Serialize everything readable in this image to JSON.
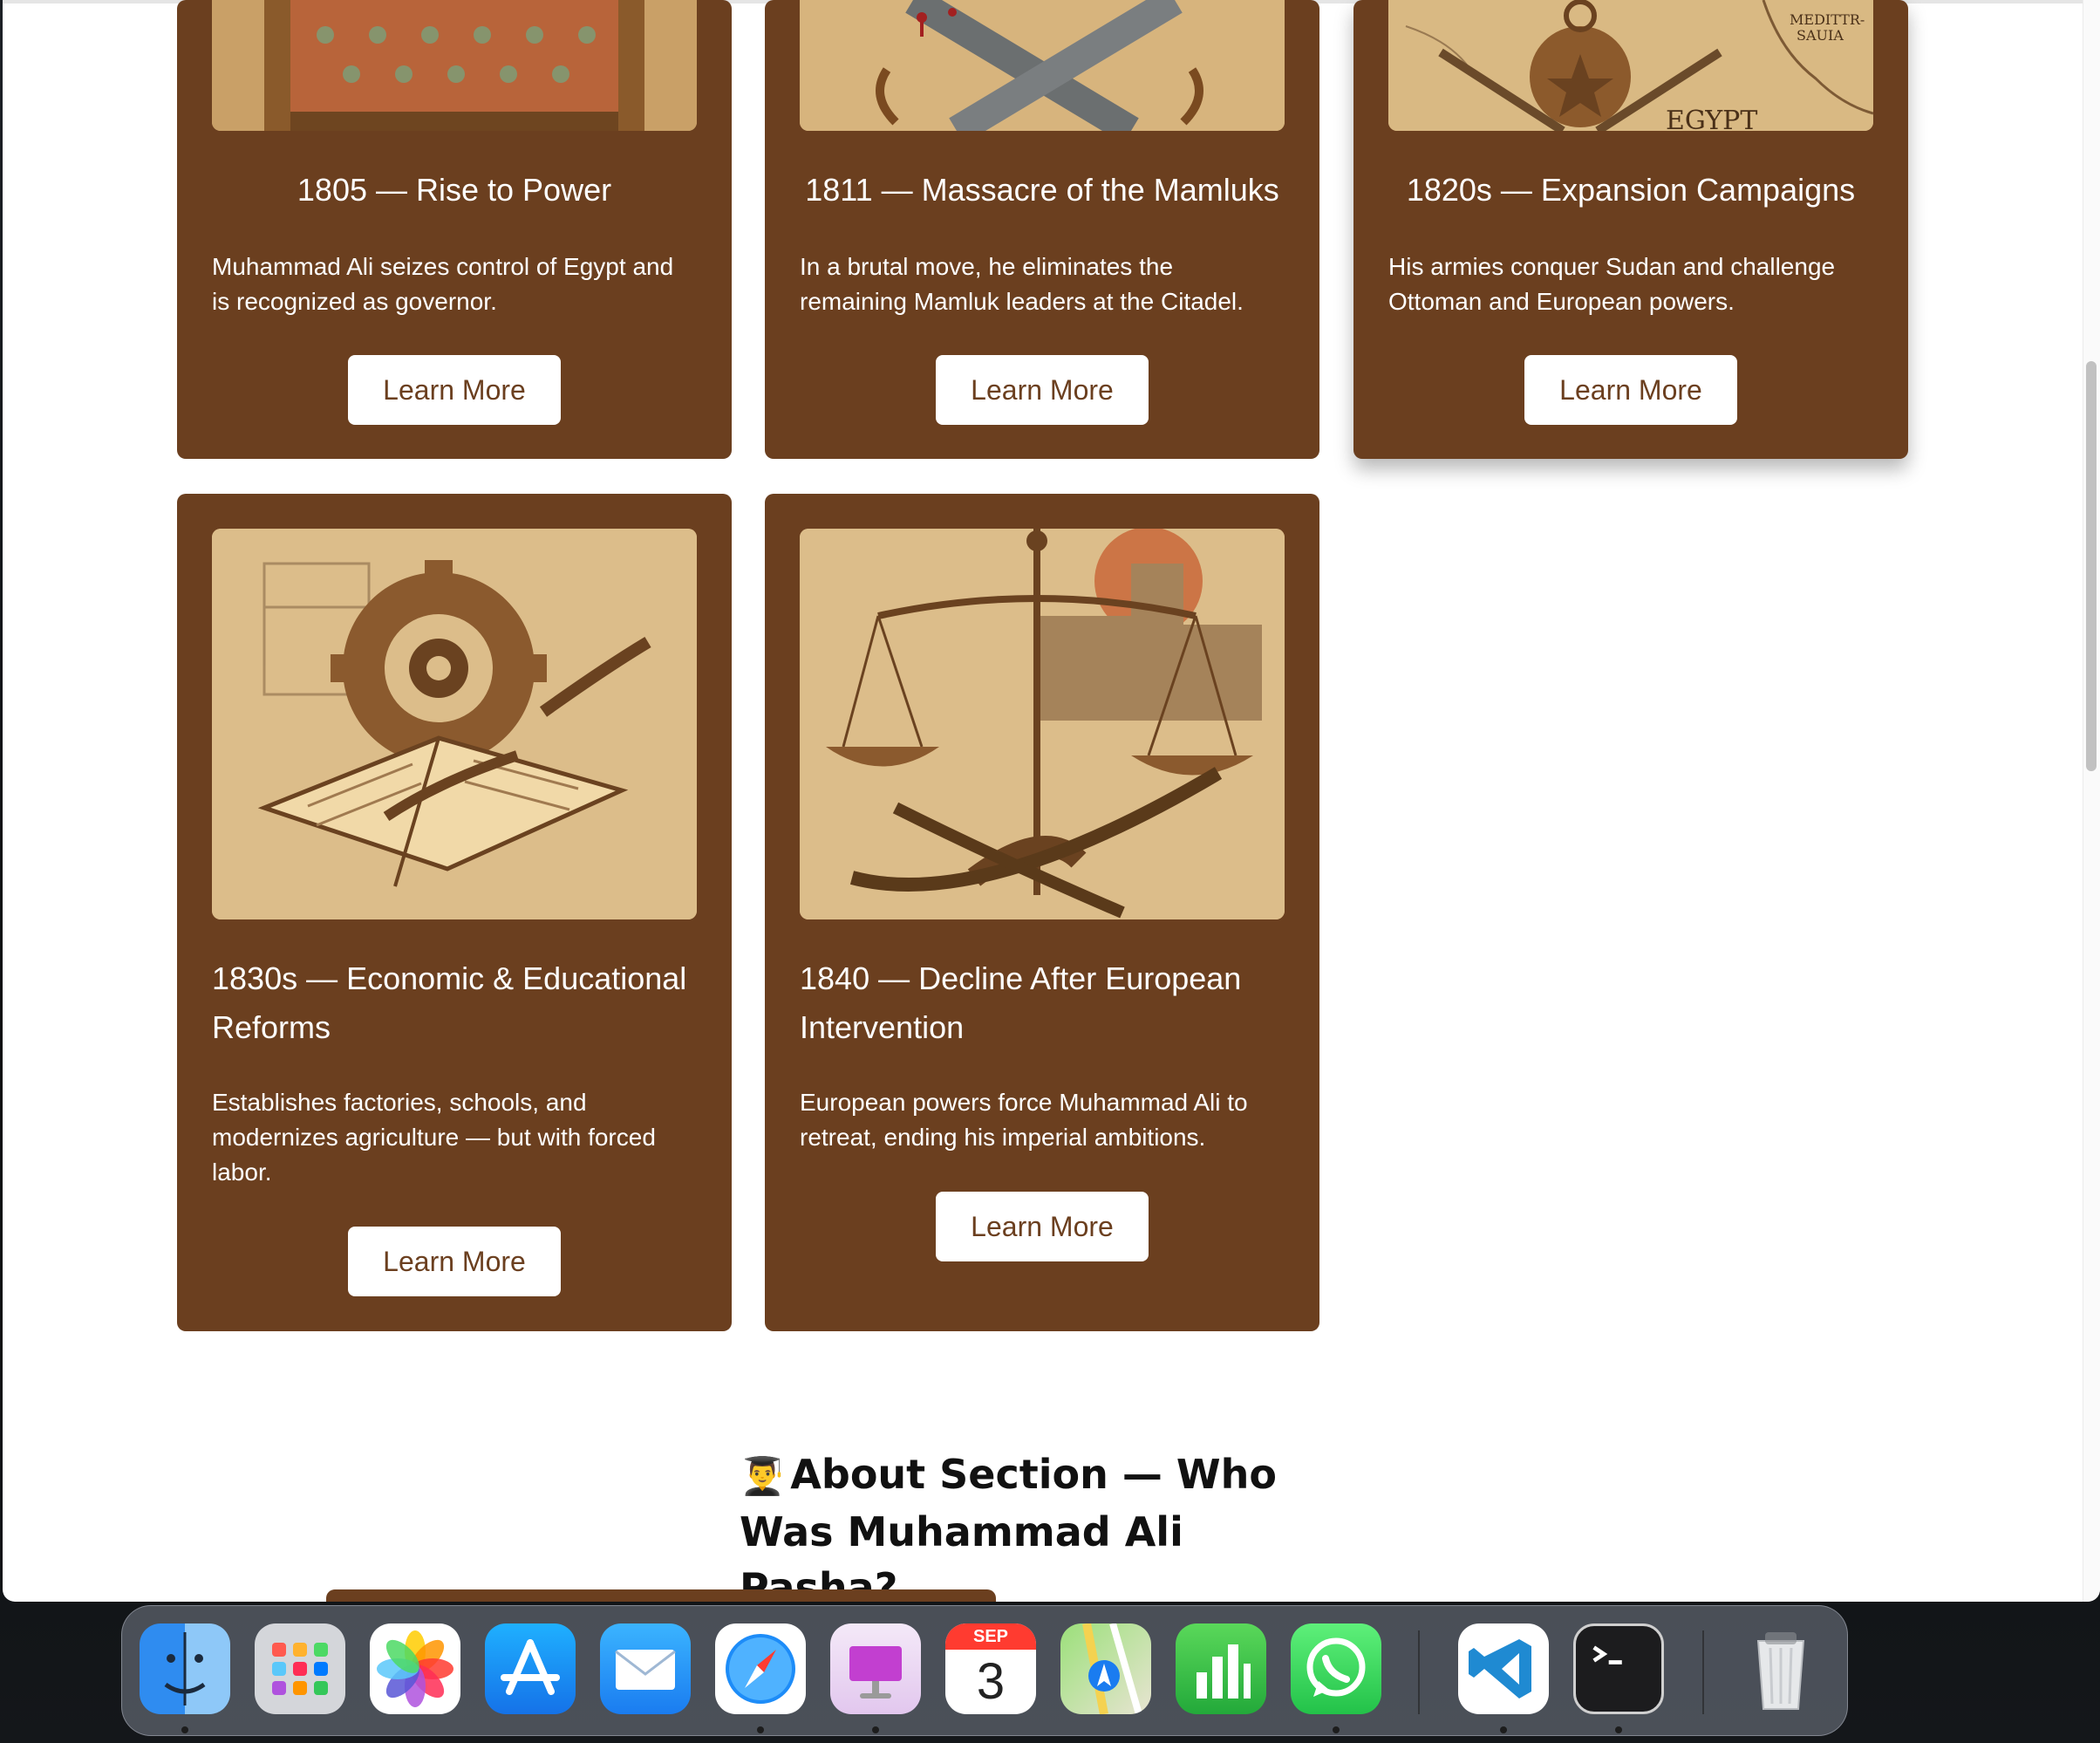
{
  "cards": [
    {
      "title": "1805 — Rise to Power",
      "description": "Muhammad Ali seizes control of Egypt and is recognized as governor.",
      "button_label": "Learn More"
    },
    {
      "title": "1811 — Massacre of the Mamluks",
      "description": "In a brutal move, he eliminates the remaining Mamluk leaders at the Citadel.",
      "button_label": "Learn More"
    },
    {
      "title": "1820s — Expansion Campaigns",
      "description": "His armies conquer Sudan and challenge Ottoman and European powers.",
      "button_label": "Learn More",
      "image_map_labels": [
        "MEDITTR-",
        "SAUIA",
        "EGYPT"
      ]
    },
    {
      "title": "1830s — Economic & Educational Reforms",
      "description": "Establishes factories, schools, and modernizes agriculture — but with forced labor.",
      "button_label": "Learn More"
    },
    {
      "title": "1840 — Decline After European Intervention",
      "description": "European powers force Muhammad Ali to retreat, ending his imperial ambitions.",
      "button_label": "Learn More"
    }
  ],
  "about": {
    "emoji": "👨‍🎓",
    "heading": "About Section — Who Was Muhammad Ali Pasha?"
  },
  "dock": {
    "apps": [
      "finder-icon",
      "launchpad-icon",
      "photos-icon",
      "app-store-icon",
      "mail-icon",
      "safari-icon",
      "keynote-icon",
      "calendar-icon",
      "maps-icon",
      "numbers-icon",
      "whatsapp-icon",
      "vscode-icon",
      "terminal-icon",
      "trash-icon"
    ],
    "calendar_month": "SEP",
    "calendar_day": "3"
  },
  "colors": {
    "card_brown": "#6b3f1f",
    "button_bg": "#ffffff",
    "page_bg": "#ffffff"
  }
}
